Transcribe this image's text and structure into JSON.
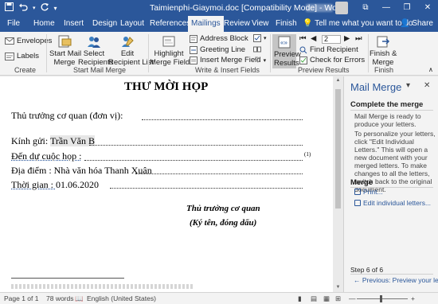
{
  "titlebar": {
    "document_title": "Taimienphi-Giaymoi.doc [Compatibility Mode] - Word",
    "save_icon": "save-icon",
    "undo_icon": "undo-icon",
    "redo_icon": "redo-icon",
    "customize_icon": "customize-qat-icon",
    "minimize": "—",
    "restore": "❐",
    "close": "✕",
    "ribbon_options": "⧉"
  },
  "tabs": [
    "File",
    "Home",
    "Insert",
    "Design",
    "Layout",
    "References",
    "Mailings",
    "Review",
    "View",
    "Finish"
  ],
  "active_tab": "Mailings",
  "tellme": "Tell me what you want to do",
  "share": "Share",
  "ribbon": {
    "create": {
      "envelopes": "Envelopes",
      "labels": "Labels",
      "group": "Create"
    },
    "start": {
      "start_mail_merge": "Start Mail\nMerge",
      "select_recipients": "Select\nRecipients",
      "edit_list": "Edit\nRecipient List",
      "group": "Start Mail Merge"
    },
    "write": {
      "highlight": "Highlight\nMerge Fields",
      "address_block": "Address Block",
      "greeting_line": "Greeting Line",
      "insert_merge_field": "Insert Merge Field",
      "group": "Write & Insert Fields"
    },
    "preview": {
      "preview_results": "Preview\nResults",
      "record_number": "2",
      "find_recipient": "Find Recipient",
      "check_errors": "Check for Errors",
      "group": "Preview Results"
    },
    "finish": {
      "finish_merge": "Finish &\nMerge",
      "group": "Finish"
    }
  },
  "document": {
    "title": "THƯ MỜI HỌP",
    "line1": "Thủ trưởng cơ quan (đơn vị):",
    "line2_label": "Kính gửi: ",
    "line2_value": "Trần Văn B",
    "line3": "Đến dự cuộc họp :",
    "footnote_mark": "(1)",
    "line4_label": "Địa điểm : ",
    "line4_value": "Nhà văn hóa Thanh Xuân",
    "line5_label": "Thời gian : ",
    "line5_value": "01.06.2020",
    "sign_title": "Thủ trưởng cơ quan",
    "sign_note": "(Ký tên, đóng dấu)"
  },
  "pane": {
    "title": "Mail Merge",
    "complete_heading": "Complete the merge",
    "ready_text": "Mail Merge is ready to produce your letters.",
    "personalize_text": "To personalize your letters, click \"Edit Individual Letters.\" This will open a new document with your merged letters. To make changes to all the letters, switch back to the original document.",
    "merge_heading": "Merge",
    "print_link": "Print...",
    "edit_link": "Edit individual letters...",
    "step": "Step 6 of 6",
    "previous_link": "Previous: Preview your letters"
  },
  "status": {
    "page": "Page 1 of 1",
    "words": "78 words",
    "language": "English (United States)",
    "zoom_label": "—",
    "zoom_plus": "+"
  },
  "colors": {
    "accent": "#2b579a",
    "ribbon": "#f3f3f3",
    "background": "#e6e6e6"
  }
}
